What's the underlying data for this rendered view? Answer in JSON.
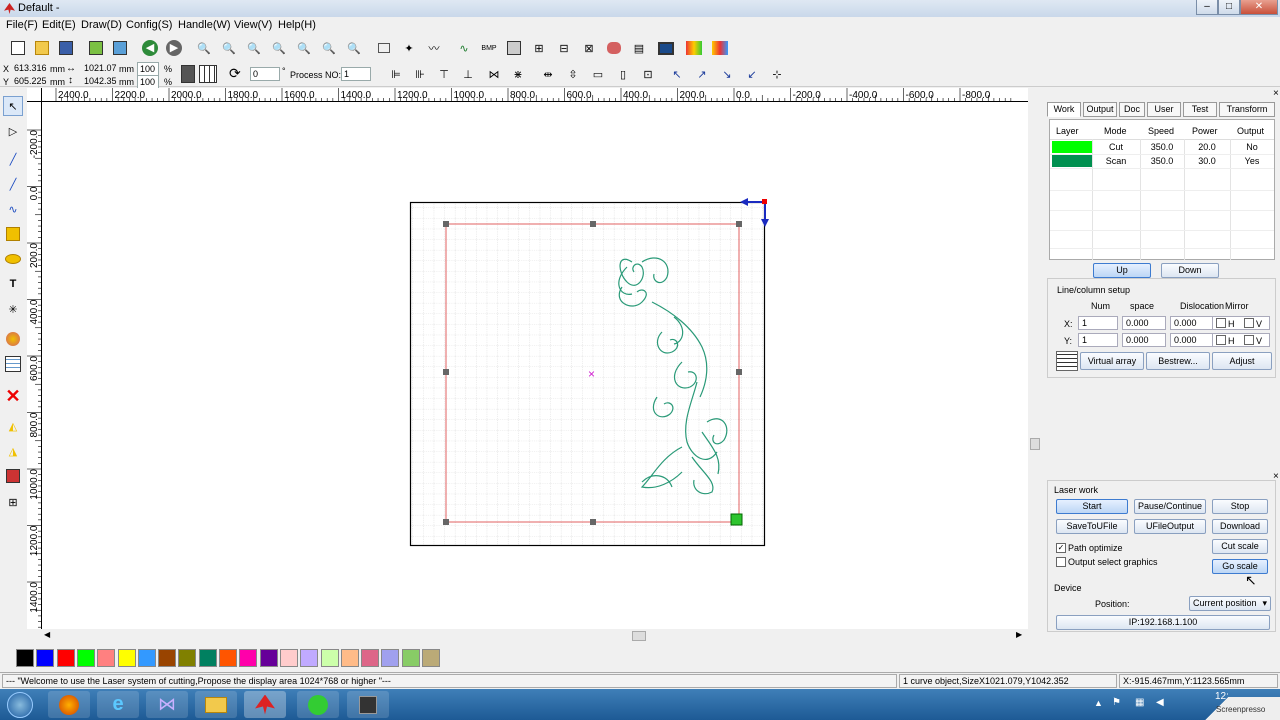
{
  "window": {
    "title": "Default -"
  },
  "menu": [
    "File(F)",
    "Edit(E)",
    "Draw(D)",
    "Config(S)",
    "Handle(W)",
    "View(V)",
    "Help(H)"
  ],
  "coords": {
    "x_label": "X",
    "x_value": "613.316",
    "y_label": "Y",
    "y_value": "605.225",
    "unit": "mm",
    "w_value": "1021.07",
    "h_value": "1042.35",
    "w_scale": "100",
    "h_scale": "100",
    "pct": "%",
    "rotation": "0",
    "deg": "°",
    "process_label": "Process NO:",
    "process_value": "1"
  },
  "ruler_top": [
    "2400.0",
    "2200.0",
    "2000.0",
    "1800.0",
    "1600.0",
    "1400.0",
    "1200.0",
    "1000.0",
    "800.0",
    "600.0",
    "400.0",
    "200.0",
    "0.0",
    "-200.0",
    "-400.0",
    "-600.0",
    "-800.0"
  ],
  "ruler_left": [
    "-200.0",
    "0.0",
    "200.0",
    "400.0",
    "600.0",
    "800.0",
    "1000.0",
    "1200.0",
    "1400.0"
  ],
  "palette": [
    "#000000",
    "#0000ff",
    "#ff0000",
    "#00ff00",
    "#ff8080",
    "#ffff00",
    "#3399ff",
    "#994400",
    "#808000",
    "#008060",
    "#ff5500",
    "#ff00aa",
    "#660099",
    "#ffcccc",
    "#c0aaff",
    "#ccffaa",
    "#ffbb88",
    "#dd6688",
    "#a0a0ee",
    "#88cc66",
    "#bbaa77"
  ],
  "panel": {
    "tabs": [
      "Work",
      "Output",
      "Doc",
      "User",
      "Test",
      "Transform"
    ],
    "layer_headers": [
      "Layer",
      "Mode",
      "Speed",
      "Power",
      "Output"
    ],
    "layers": [
      {
        "color": "#00ff00",
        "mode": "Cut",
        "speed": "350.0",
        "power": "20.0",
        "output": "No"
      },
      {
        "color": "#009050",
        "mode": "Scan",
        "speed": "350.0",
        "power": "30.0",
        "output": "Yes"
      }
    ],
    "up": "Up",
    "down": "Down",
    "line_setup": "Line/column setup",
    "grid_headers": [
      "Num",
      "space",
      "Dislocation",
      "Mirror"
    ],
    "rows": [
      {
        "axis": "X:",
        "num": "1",
        "space": "0.000",
        "disloc": "0.000",
        "h": "H",
        "v": "V"
      },
      {
        "axis": "Y:",
        "num": "1",
        "space": "0.000",
        "disloc": "0.000",
        "h": "H",
        "v": "V"
      }
    ],
    "virtual": "Virtual array",
    "bestrew": "Bestrew...",
    "adjust": "Adjust",
    "laser_work": "Laser work",
    "start": "Start",
    "pause": "Pause/Continue",
    "stop": "Stop",
    "savefile": "SaveToUFile",
    "ufile": "UFileOutput",
    "download": "Download",
    "path_opt": "Path optimize",
    "out_sel": "Output select graphics",
    "cut_scale": "Cut scale",
    "go_scale": "Go scale",
    "device": "Device",
    "position_label": "Position:",
    "position_value": "Current position",
    "ip": "IP:192.168.1.100"
  },
  "status": {
    "message": "--- \"Welcome to use the Laser system of cutting,Propose the display area 1024*768 or higher \"---",
    "selection": "1 curve object,SizeX1021.079,Y1042.352",
    "cursor": "X:-915.467mm,Y:1123.565mm"
  },
  "taskbar": {
    "time": "12:",
    "watermark": "Screenpresso"
  }
}
